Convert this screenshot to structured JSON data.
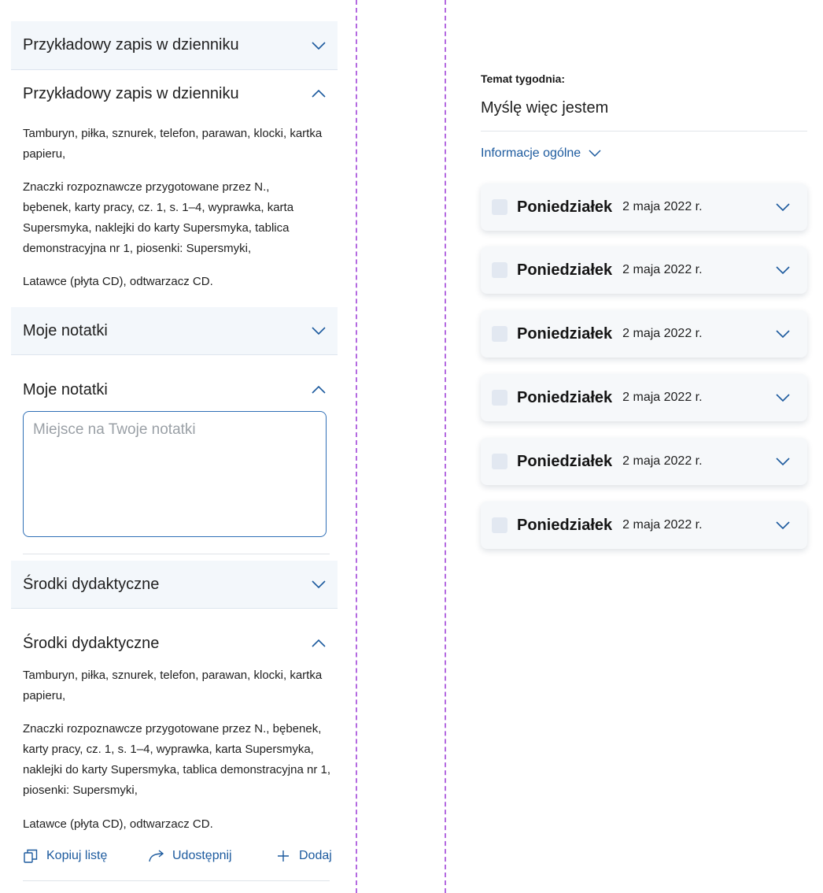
{
  "left": {
    "journal_closed": {
      "title": "Przykładowy zapis w dzienniku"
    },
    "journal_open": {
      "title": "Przykładowy zapis w dzienniku",
      "paragraphs": [
        "Tamburyn, piłka, sznurek, telefon, parawan, klocki, kartka papieru,",
        "Znaczki rozpoznawcze przygotowane przez N., bębenek, karty pracy, cz. 1, s. 1–4, wyprawka, karta Supersmyka, naklejki do karty Supersmyka, tablica demonstracyjna nr 1, piosenki: Supersmyki,",
        "Latawce (płyta CD), odtwarzacz CD."
      ]
    },
    "notes_closed": {
      "title": "Moje notatki"
    },
    "notes_open": {
      "title": "Moje notatki",
      "placeholder": "Miejsce na Twoje notatki"
    },
    "materials_closed": {
      "title": "Środki dydaktyczne"
    },
    "materials_open": {
      "title": "Środki dydaktyczne",
      "paragraphs": [
        "Tamburyn, piłka, sznurek, telefon, parawan, klocki, kartka papieru,",
        "Znaczki rozpoznawcze przygotowane przez N., bębenek, karty pracy, cz. 1, s. 1–4, wyprawka, karta Supersmyka, naklejki do karty Supersmyka, tablica demonstracyjna nr 1, piosenki: Supersmyki,",
        "Latawce (płyta CD), odtwarzacz CD."
      ],
      "actions": {
        "copy": {
          "label": "Kopiuj listę",
          "icon": "copy-icon"
        },
        "share": {
          "label": "Udostępnij",
          "icon": "share-arrow-icon"
        },
        "add": {
          "label": "Dodaj",
          "icon": "plus-icon"
        }
      }
    }
  },
  "right": {
    "week_label": "Temat tygodnia:",
    "week_title": "Myślę więc jestem",
    "info_link": "Informacje ogólne",
    "days": [
      {
        "name": "Poniedziałek",
        "date": "2 maja 2022 r."
      },
      {
        "name": "Poniedziałek",
        "date": "2 maja 2022 r."
      },
      {
        "name": "Poniedziałek",
        "date": "2 maja 2022 r."
      },
      {
        "name": "Poniedziałek",
        "date": "2 maja 2022 r."
      },
      {
        "name": "Poniedziałek",
        "date": "2 maja 2022 r."
      },
      {
        "name": "Poniedziałek",
        "date": "2 maja 2022 r."
      }
    ]
  },
  "colors": {
    "accent": "#1c5a9e",
    "guide": "#b46ae0",
    "panel": "#f3f7fb"
  }
}
